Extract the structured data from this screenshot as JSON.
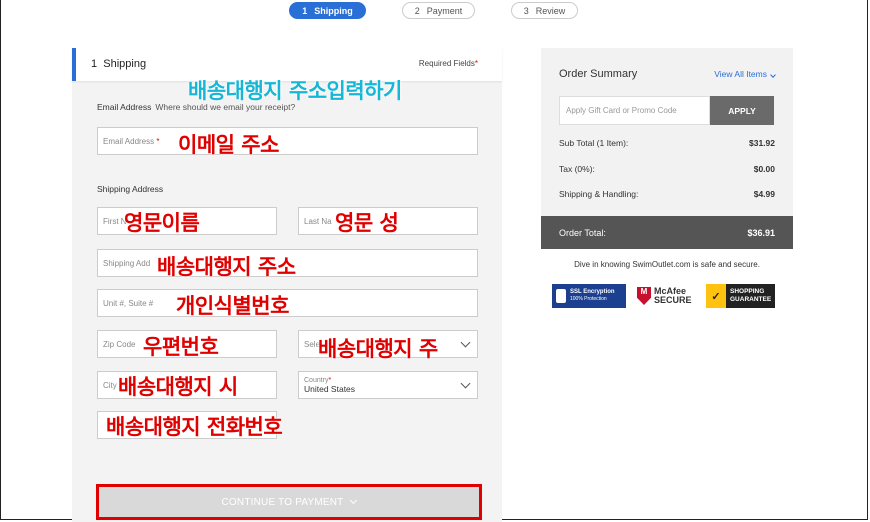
{
  "steps": [
    {
      "num": "1",
      "label": "Shipping"
    },
    {
      "num": "2",
      "label": "Payment"
    },
    {
      "num": "3",
      "label": "Review"
    }
  ],
  "form": {
    "section_num": "1",
    "section_title": "Shipping",
    "required_label": "Required Fields",
    "required_star": "*",
    "email_label": "Email Address",
    "email_hint": "Where should we email your receipt?",
    "email_placeholder": "Email Address",
    "shipping_label": "Shipping Address",
    "first_name": "First N",
    "last_name": "Last Na",
    "address": "Shipping Add",
    "unit": "Unit #, Suite #",
    "zip": "Zip Code",
    "state": "Sele",
    "city": "City",
    "country_label": "Country",
    "country_value": "United States",
    "continue_label": "CONTINUE TO PAYMENT"
  },
  "overlays": {
    "title": "배송대행지 주소입력하기",
    "email": "이메일 주소",
    "first": "영문이름",
    "last": "영문 성",
    "address": "배송대행지 주소",
    "unit": "개인식별번호",
    "zip": "우편번호",
    "state": "배송대행지 주",
    "city": "배송대행지 시",
    "phone": "배송대행지 전화번호"
  },
  "summary": {
    "title": "Order Summary",
    "view_all": "View All Items",
    "promo_placeholder": "Apply Gift Card or Promo Code",
    "apply": "APPLY",
    "rows": [
      {
        "label": "Sub Total (1 Item):",
        "amount": "$31.92"
      },
      {
        "label": "Tax (0%):",
        "amount": "$0.00"
      },
      {
        "label": "Shipping & Handling:",
        "amount": "$4.99"
      }
    ],
    "total_label": "Order Total:",
    "total_amount": "$36.91",
    "secure_text": "Dive in knowing SwimOutlet.com is safe and secure."
  },
  "badges": {
    "ssl_title": "SSL Encryption",
    "ssl_sub": "100% Protection",
    "mcafee_1": "McAfee",
    "mcafee_2": "SECURE",
    "norton_1": "SHOPPING",
    "norton_2": "GUARANTEE"
  },
  "colors": {
    "accent": "#2a6fd6",
    "overlay_red": "#e00000",
    "overlay_cyan": "#16b6d6"
  }
}
